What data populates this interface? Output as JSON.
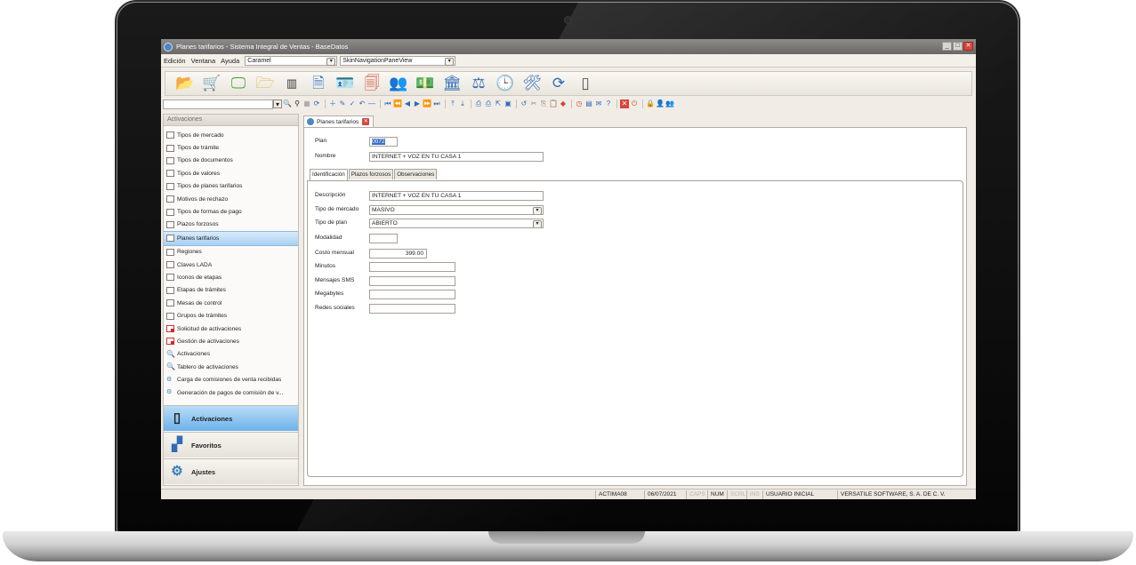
{
  "window": {
    "title": "Planes tarifarios - Sistema Integral de Ventas - BaseDatos",
    "controls": [
      "_",
      "□",
      "✕"
    ]
  },
  "menubar": {
    "items": [
      "Edición",
      "Ventana",
      "Ayuda"
    ],
    "skin_combo": "Caramel",
    "view_combo": "SkinNavigationPaneView"
  },
  "navpane": {
    "header": "Activaciones",
    "items": [
      {
        "label": "Tipos de mercado",
        "icon": "table-icon"
      },
      {
        "label": "Tipos de trámite",
        "icon": "table-icon"
      },
      {
        "label": "Tipos de documentos",
        "icon": "table-icon"
      },
      {
        "label": "Tipos de valores",
        "icon": "table-icon"
      },
      {
        "label": "Tipos de planes tarifarios",
        "icon": "table-icon"
      },
      {
        "label": "Motivos de rechazo",
        "icon": "table-icon"
      },
      {
        "label": "Tipos de formas de pago",
        "icon": "table-icon"
      },
      {
        "label": "Plazos forzosos",
        "icon": "table-icon"
      },
      {
        "label": "Planes tarifarios",
        "icon": "table-icon",
        "selected": true
      },
      {
        "label": "Regiones",
        "icon": "table-icon"
      },
      {
        "label": "Claves LADA",
        "icon": "table-icon"
      },
      {
        "label": "Iconos de etapas",
        "icon": "table-icon"
      },
      {
        "label": "Etapas de trámites",
        "icon": "table-icon"
      },
      {
        "label": "Mesas de control",
        "icon": "table-icon"
      },
      {
        "label": "Grupos de trámites",
        "icon": "table-icon"
      },
      {
        "label": "Solicitud de activaciones",
        "icon": "form-icon"
      },
      {
        "label": "Gestión de activaciones",
        "icon": "form-icon"
      },
      {
        "label": "Activaciones",
        "icon": "search-icon"
      },
      {
        "label": "Tablero de activaciones",
        "icon": "search-icon"
      },
      {
        "label": "Carga de comisiones de venta recibidas",
        "icon": "cogs-icon"
      },
      {
        "label": "Generación de pagos de comisión de v...",
        "icon": "cogs-icon"
      }
    ],
    "groups": [
      {
        "label": "Activaciones",
        "icon": "phone-icon",
        "active": true
      },
      {
        "label": "Favoritos",
        "icon": "org-chart-icon"
      },
      {
        "label": "Ajustes",
        "icon": "gears-icon"
      }
    ]
  },
  "document": {
    "tab_label": "Planes tarifarios",
    "plan_label": "Plan",
    "plan_value": "0072",
    "nombre_label": "Nombre",
    "nombre_value": "INTERNET + VOZ EN TU CASA 1",
    "tabs": [
      "Identificación",
      "Plazos forzosos",
      "Observaciones"
    ],
    "fields": {
      "descripcion_label": "Descripción",
      "descripcion_value": "INTERNET + VOZ EN TU CASA 1",
      "tipo_mercado_label": "Tipo de mercado",
      "tipo_mercado_value": "MASIVO",
      "tipo_plan_label": "Tipo de plan",
      "tipo_plan_value": "ABIERTO",
      "modalidad_label": "Modalidad",
      "modalidad_value": "",
      "costo_label": "Costo mensual",
      "costo_value": "399.00",
      "minutos_label": "Minutos",
      "minutos_value": "",
      "sms_label": "Mensajes SMS",
      "sms_value": "",
      "megabytes_label": "Megabytes",
      "megabytes_value": "",
      "redes_label": "Redes sociales",
      "redes_value": ""
    }
  },
  "statusbar": {
    "user_code": "ACTIMA08",
    "date": "06/07/2021",
    "caps": "CAPS",
    "num": "NUM",
    "scrl": "SCRL",
    "ins": "INS",
    "user_name": "USUARIO INICIAL",
    "company": "VERSATILE SOFTWARE, S. A. DE C. V."
  },
  "colors": {
    "accent_selected": "#a8d0f2",
    "active_group": "#6cb2ea",
    "close_red": "#d9453a"
  }
}
